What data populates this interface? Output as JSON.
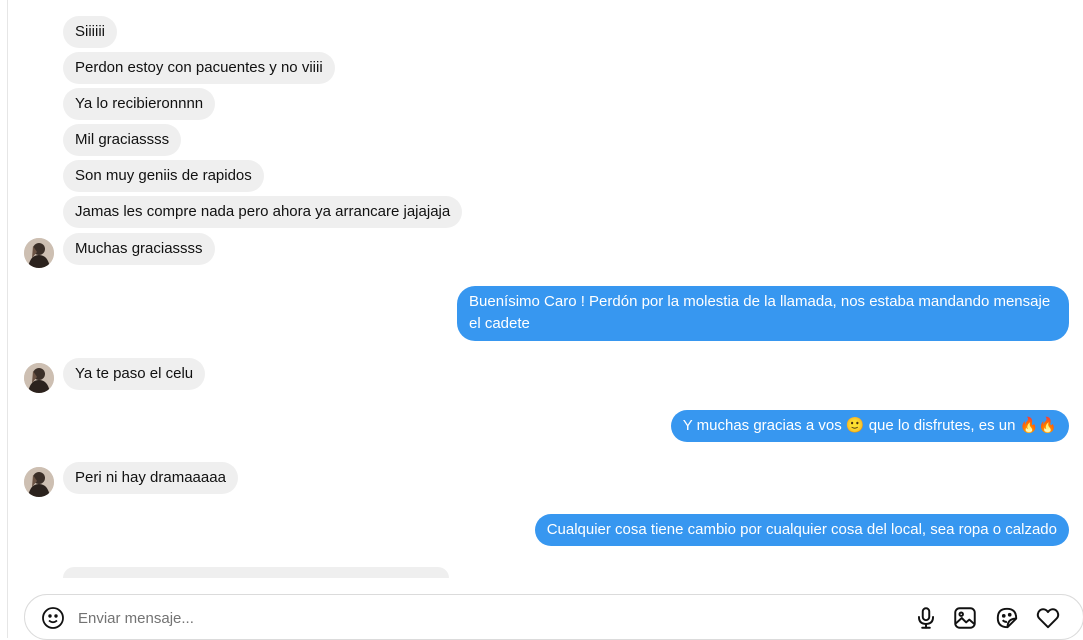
{
  "messages": [
    {
      "side": "in",
      "text": "Siiiiii",
      "avatar": false
    },
    {
      "side": "in",
      "text": "Perdon estoy con pacuentes y no viiii",
      "avatar": false
    },
    {
      "side": "in",
      "text": "Ya lo recibieronnnn",
      "avatar": false
    },
    {
      "side": "in",
      "text": "Mil graciassss",
      "avatar": false
    },
    {
      "side": "in",
      "text": "Son muy geniis de rapidos",
      "avatar": false
    },
    {
      "side": "in",
      "text": "Jamas les compre nada pero ahora ya arrancare jajajaja",
      "avatar": false
    },
    {
      "side": "in",
      "text": "Muchas graciassss",
      "avatar": true
    },
    {
      "side": "out",
      "text": "Buenísimo Caro ! Perdón por la molestia de la llamada, nos estaba mandando mensaje el cadete"
    },
    {
      "side": "in",
      "text": "Ya te paso el celu",
      "avatar": true
    },
    {
      "side": "out",
      "text": "Y muchas gracias a vos 🙂 que lo disfrutes, es un 🔥🔥"
    },
    {
      "side": "in",
      "text": "Peri ni hay dramaaaaa",
      "avatar": true
    },
    {
      "side": "out",
      "text": "Cualquier cosa tiene cambio por cualquier cosa del local, sea ropa o calzado"
    }
  ],
  "composer": {
    "placeholder": "Enviar mensaje...",
    "icons": [
      "emoji-icon",
      "microphone-icon",
      "image-icon",
      "sticker-icon",
      "heart-icon"
    ]
  },
  "colors": {
    "outgoing_bubble": "#3797f0",
    "incoming_bubble": "#efefef"
  }
}
